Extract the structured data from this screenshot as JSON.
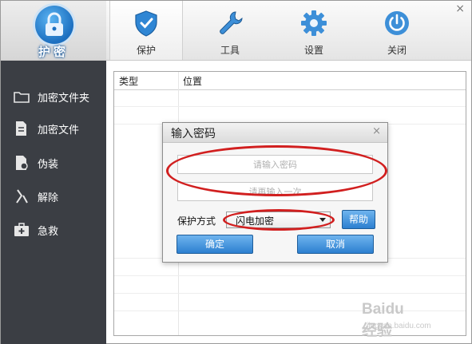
{
  "app": {
    "brand_label": "护密",
    "close_glyph": "×"
  },
  "toolbar": {
    "tabs": [
      {
        "label": "保护",
        "icon": "shield-icon",
        "active": true
      },
      {
        "label": "工具",
        "icon": "wrench-icon",
        "active": false
      },
      {
        "label": "设置",
        "icon": "gear-icon",
        "active": false
      },
      {
        "label": "关闭",
        "icon": "power-icon",
        "active": false
      }
    ]
  },
  "sidebar": {
    "items": [
      {
        "label": "加密文件夹",
        "icon": "folder-icon"
      },
      {
        "label": "加密文件",
        "icon": "file-icon"
      },
      {
        "label": "伪装",
        "icon": "disguise-icon"
      },
      {
        "label": "解除",
        "icon": "unlock-icon"
      },
      {
        "label": "急救",
        "icon": "first-aid-icon"
      }
    ]
  },
  "list": {
    "columns": [
      "类型",
      "位置"
    ]
  },
  "dialog": {
    "title": "输入密码",
    "close_glyph": "×",
    "password_placeholder": "请输入密码",
    "confirm_placeholder": "请再输入一次",
    "mode_label": "保护方式",
    "mode_value": "闪电加密",
    "help_label": "帮助",
    "ok_label": "确定",
    "cancel_label": "取消"
  },
  "watermark": {
    "brand": "Baidu 经验",
    "url": "jingyan.baidu.com"
  },
  "colors": {
    "sidebar_bg": "#3b3e44",
    "button_blue": "#2c7fd0",
    "annotation_red": "#d11f1f"
  }
}
